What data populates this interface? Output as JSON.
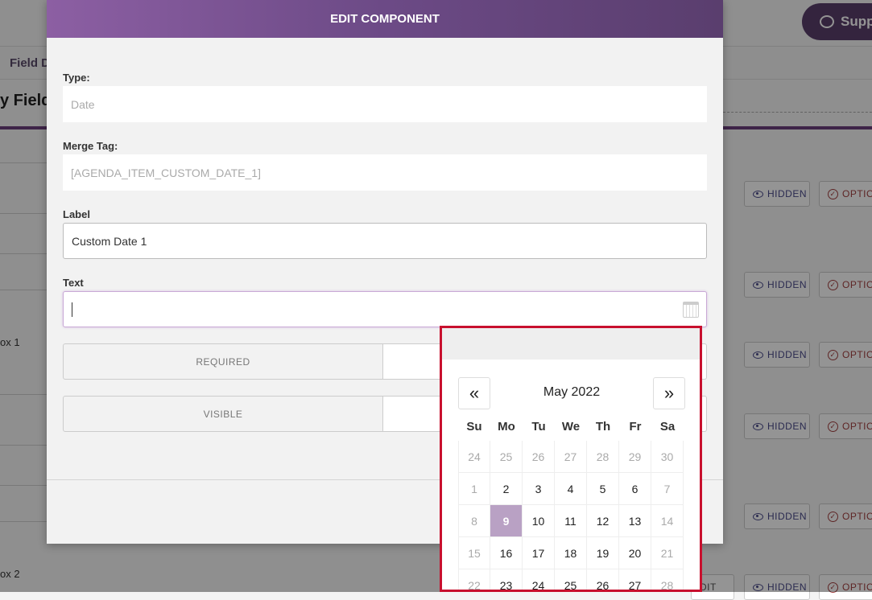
{
  "background": {
    "support_label": "Supp",
    "tab_label": "Field D",
    "section_title": "y Field",
    "row_labels": [
      "ox 1",
      "ox 2"
    ],
    "hidden_label": "HIDDEN",
    "options_label": "OPTIO",
    "edit_label": "DIT"
  },
  "modal": {
    "title": "EDIT COMPONENT",
    "type": {
      "label": "Type:",
      "value": "Date"
    },
    "merge_tag": {
      "label": "Merge Tag:",
      "value": "[AGENDA_ITEM_CUSTOM_DATE_1]"
    },
    "label_field": {
      "label": "Label",
      "value": "Custom Date 1"
    },
    "text_field": {
      "label": "Text",
      "value": ""
    },
    "required_label": "REQUIRED",
    "visible_label": "VISIBLE"
  },
  "datepicker": {
    "month_label": "May 2022",
    "prev_symbol": "«",
    "next_symbol": "»",
    "weekdays": [
      "Su",
      "Mo",
      "Tu",
      "We",
      "Th",
      "Fr",
      "Sa"
    ],
    "weeks": [
      [
        "24",
        "25",
        "26",
        "27",
        "28",
        "29",
        "30"
      ],
      [
        "1",
        "2",
        "3",
        "4",
        "5",
        "6",
        "7"
      ],
      [
        "8",
        "9",
        "10",
        "11",
        "12",
        "13",
        "14"
      ],
      [
        "15",
        "16",
        "17",
        "18",
        "19",
        "20",
        "21"
      ],
      [
        "22",
        "23",
        "24",
        "25",
        "26",
        "27",
        "28"
      ]
    ],
    "selected": "9",
    "highlight_color": "#b9a1c4",
    "frame_color": "#c8102e"
  }
}
